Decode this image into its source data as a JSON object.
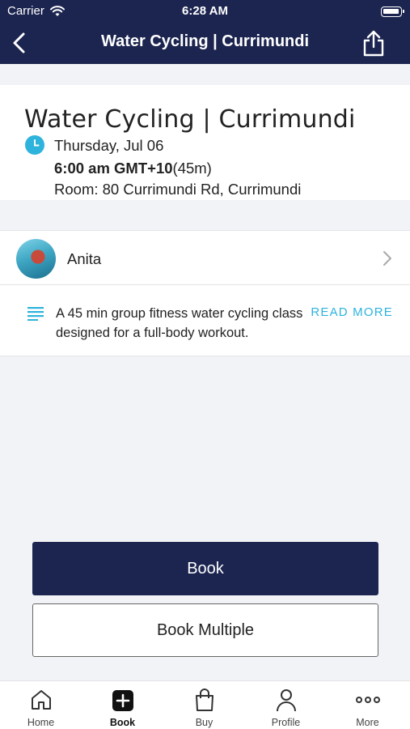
{
  "status_bar": {
    "carrier": "Carrier",
    "time": "6:28 AM"
  },
  "nav": {
    "title": "Water Cycling | Currimundi"
  },
  "class": {
    "title": "Water Cycling | Currimundi",
    "date": "Thursday, Jul 06",
    "time": "6:00 am GMT+10",
    "duration": "(45m)",
    "room": "Room: 80 Currimundi Rd, Currimundi"
  },
  "instructor": {
    "name": "Anita"
  },
  "description": {
    "text": "A 45 min group fitness water cycling class designed for a full-body workout.",
    "read_more": "READ MORE"
  },
  "buttons": {
    "book": "Book",
    "book_multiple": "Book Multiple"
  },
  "tabbar": {
    "items": [
      {
        "label": "Home",
        "icon": "home-icon"
      },
      {
        "label": "Book",
        "icon": "book-plus-icon"
      },
      {
        "label": "Buy",
        "icon": "shopping-bag-icon"
      },
      {
        "label": "Profile",
        "icon": "profile-icon"
      },
      {
        "label": "More",
        "icon": "more-dots-icon"
      }
    ],
    "active": "Book"
  },
  "colors": {
    "primary": "#1c2550",
    "accent": "#2eb3dd",
    "background": "#f2f3f6"
  }
}
